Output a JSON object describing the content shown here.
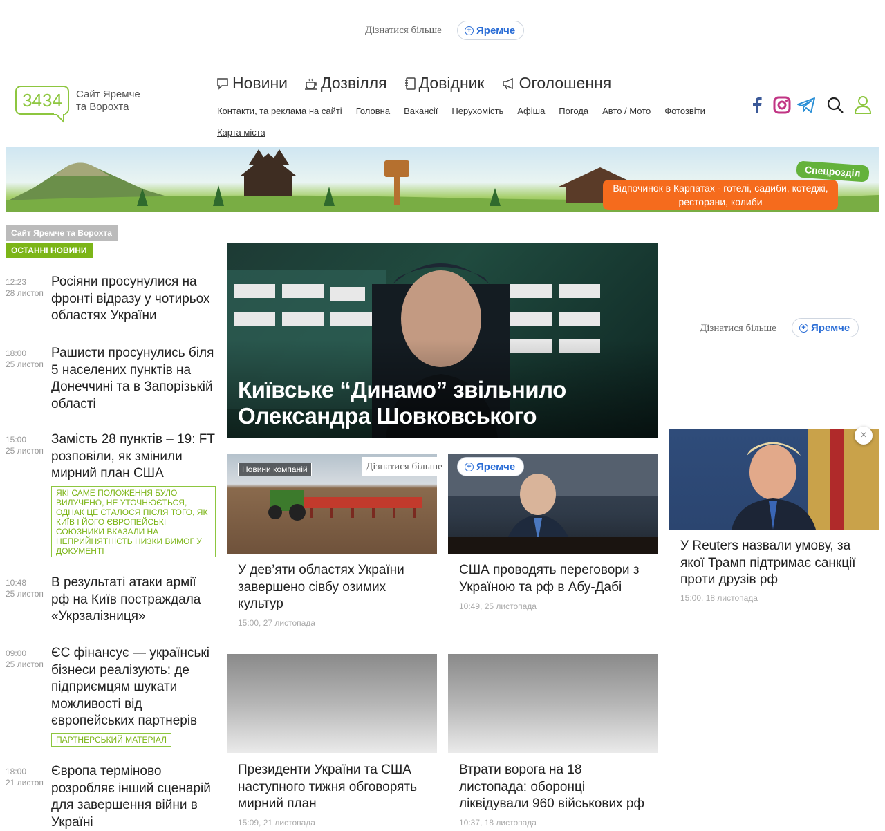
{
  "top_ad": {
    "more_label": "Дізнатися більше",
    "button_label": "Яремче"
  },
  "header": {
    "logo_number": "3434",
    "logo_line1": "Сайт Яремче",
    "logo_line2": "та Ворохта",
    "main_nav": [
      {
        "label": "Новини",
        "icon": "speech-bubble-icon"
      },
      {
        "label": "Дозвілля",
        "icon": "coffee-cup-icon"
      },
      {
        "label": "Довідник",
        "icon": "notebook-icon"
      },
      {
        "label": "Оголошення",
        "icon": "megaphone-icon"
      }
    ],
    "sub_nav": [
      "Контакти, та реклама на сайті",
      "Головна",
      "Вакансії",
      "Нерухомість",
      "Афіша",
      "Погода",
      "Авто / Мото",
      "Фотозвіти",
      "Карта міста"
    ],
    "social": [
      "facebook-icon",
      "instagram-icon",
      "telegram-icon",
      "search-icon",
      "user-icon"
    ],
    "colors": {
      "brand": "#8dc63f",
      "facebook": "#3b5998",
      "instagram": "#c13584",
      "telegram": "#2a8fd6"
    }
  },
  "banner": {
    "badge": "Спецрозділ",
    "cta_line1": "Відпочинок в Карпатах - готелі, садиби, котеджі,",
    "cta_line2": "ресторани, колиби"
  },
  "sidebar": {
    "site_tag": "Сайт Яремче та Ворохта",
    "section_tag": "ОСТАННІ НОВИНИ",
    "items": [
      {
        "time": "12:23",
        "date": "28 листопада",
        "title": "Росіяни просунулися на фронті відразу у чотирьох областях України",
        "note": ""
      },
      {
        "time": "18:00",
        "date": "25 листопада",
        "title": "Рашисти просунулись біля 5 населених пунктів на Донеччині та в Запорізькій області",
        "note": ""
      },
      {
        "time": "15:00",
        "date": "25 листопада",
        "title": "Замість 28 пунктів – 19: FT розповіли, як змінили мирний план США",
        "note": "ЯКІ САМЕ ПОЛОЖЕННЯ БУЛО ВИЛУЧЕНО, НЕ УТОЧНЮЄТЬСЯ, ОДНАК ЦЕ СТАЛОСЯ ПІСЛЯ ТОГО, ЯК КИЇВ І ЙОГО ЄВРОПЕЙСЬКІ СОЮЗНИКИ ВКАЗАЛИ НА НЕПРИЙНЯТНІСТЬ НИЗКИ ВИМОГ У ДОКУМЕНТІ"
      },
      {
        "time": "10:48",
        "date": "25 листопада",
        "title": "В результаті атаки армії рф на Київ постраждала «Укрзалізниця»",
        "note": ""
      },
      {
        "time": "09:00",
        "date": "25 листопада",
        "title": "ЄС фінансує — українські бізнеси реалізують: де підприємцям шукати можливості від європейських партнерів",
        "note": "ПАРТНЕРСЬКИЙ МАТЕРІАЛ"
      },
      {
        "time": "18:00",
        "date": "21 листопада",
        "title": "Європа терміново розробляє інший сценарій для завершення війни в Україні",
        "note": ""
      }
    ]
  },
  "hero": {
    "title": "Київське “Динамо” звільнило Олександра Шовковського"
  },
  "cards": [
    {
      "label": "Новини компаній",
      "title": "У дев’яти областях України завершено сівбу озимих культур",
      "date": "15:00, 27 листопада"
    },
    {
      "label": "",
      "title": "США проводять переговори з Україною та рф в Абу-Дабі",
      "date": "10:49, 25 листопада"
    },
    {
      "label": "",
      "title": "Президенти України та США наступного тижня обговорять мирний план",
      "date": "15:09, 21 листопада"
    },
    {
      "label": "",
      "title": "Втрати ворога на 18 листопада: оборонці ліквідували 960 військових рф",
      "date": "10:37, 18 листопада"
    }
  ],
  "inline_ad": {
    "more_label": "Дізнатися більше",
    "button_label": "Яремче"
  },
  "right": {
    "ad_more_label": "Дізнатися більше",
    "ad_button_label": "Яремче",
    "card_title": "У Reuters назвали умову, за якої Трамп підтримає санкції проти друзів рф",
    "card_date": "15:00, 18 листопада",
    "close_icon": "×"
  }
}
